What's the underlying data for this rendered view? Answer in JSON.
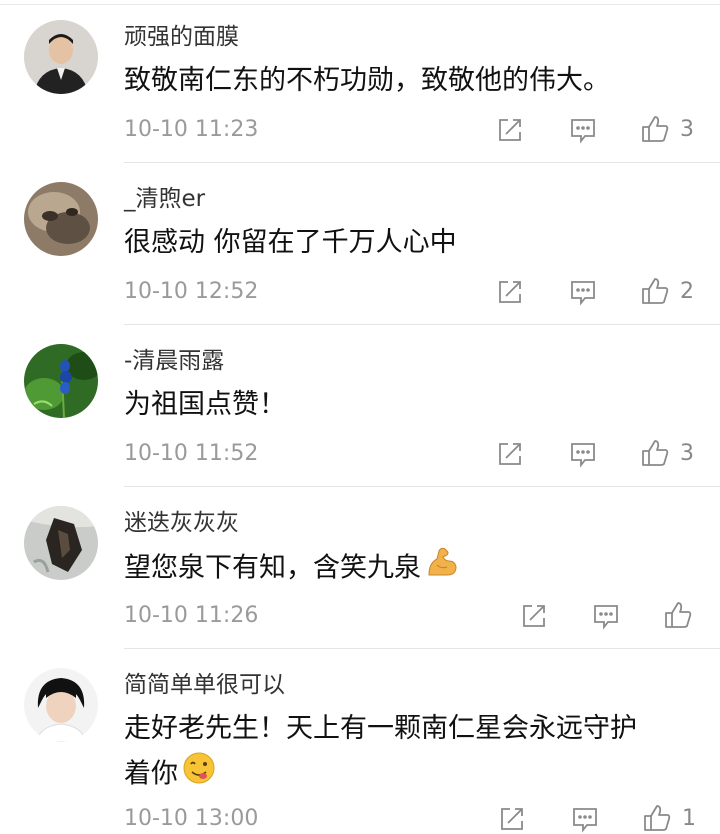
{
  "comments": [
    {
      "username": "顽强的面膜",
      "content": "致敬南仁东的不朽功勋，致敬他的伟大。",
      "time": "10-10 11:23",
      "likes": "3"
    },
    {
      "username": "_清煦er",
      "content": "很感动 你留在了千万人心中",
      "time": "10-10 12:52",
      "likes": "2"
    },
    {
      "username": "-清晨雨露",
      "content": "为祖国点赞！",
      "time": "10-10 11:52",
      "likes": "3"
    },
    {
      "username": "迷迭灰灰灰",
      "content": "望您泉下有知，含笑九泉",
      "time": "10-10 11:26",
      "likes": ""
    },
    {
      "username": "简简单单很可以",
      "content_line1": "走好老先生！天上有一颗南仁星会永远守护",
      "content_line2": "着你",
      "time": "10-10 13:00",
      "likes": "1"
    }
  ],
  "icons": {
    "share": "share-icon",
    "reply": "comment-icon",
    "like": "thumbs-up-icon",
    "flex_emoji": "flexed-biceps-emoji",
    "yum_emoji": "yum-face-emoji"
  },
  "colors": {
    "username": "#333333",
    "content": "#111111",
    "meta": "#9a9a9a",
    "icon": "#8a8a8a",
    "divider": "#e5e5e5"
  }
}
